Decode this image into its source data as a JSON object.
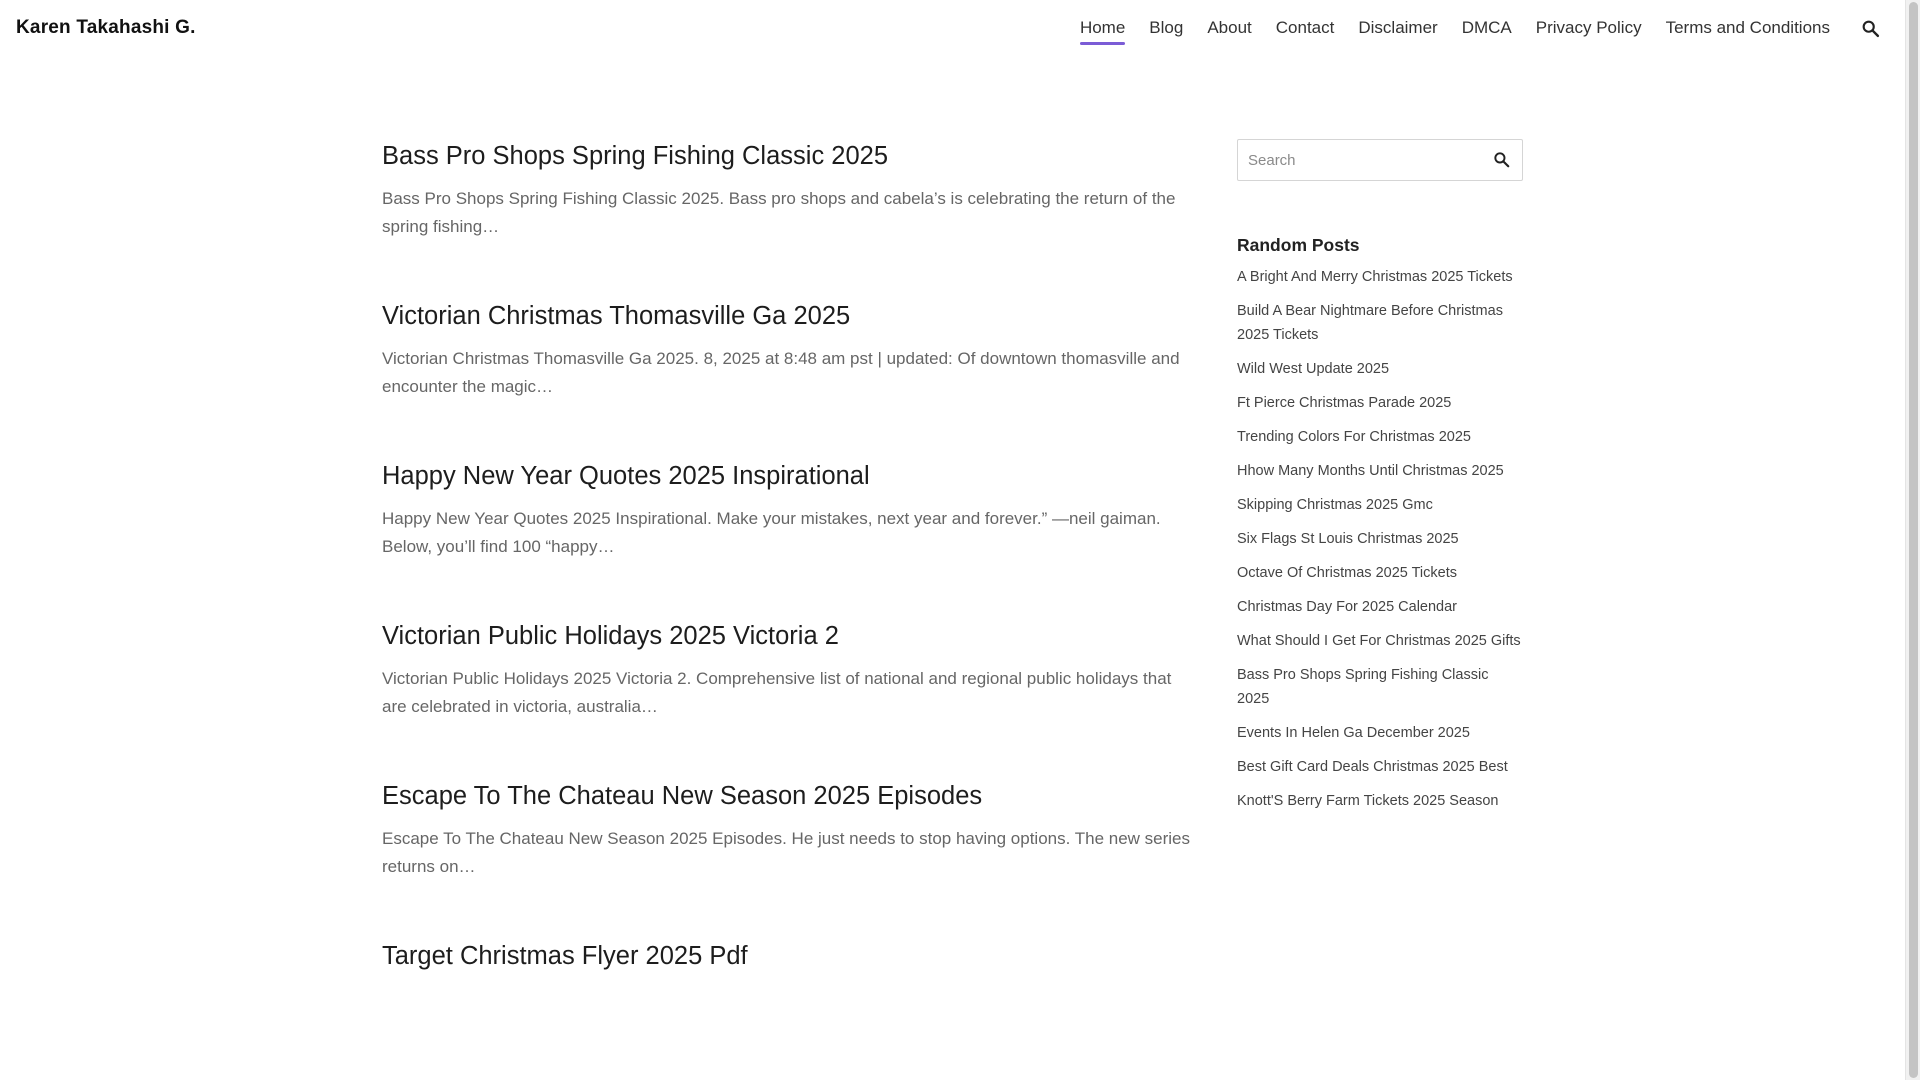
{
  "site": {
    "title": "Karen Takahashi G."
  },
  "nav": {
    "items": [
      {
        "label": "Home"
      },
      {
        "label": "Blog"
      },
      {
        "label": "About"
      },
      {
        "label": "Contact"
      },
      {
        "label": "Disclaimer"
      },
      {
        "label": "DMCA"
      },
      {
        "label": "Privacy Policy"
      },
      {
        "label": "Terms and Conditions"
      }
    ],
    "active": "Home",
    "search_icon": "search-icon"
  },
  "posts": [
    {
      "title": "Bass Pro Shops Spring Fishing Classic 2025",
      "excerpt": "Bass Pro Shops Spring Fishing Classic 2025. Bass pro shops and cabela’s is celebrating the return of the spring fishing…"
    },
    {
      "title": "Victorian Christmas Thomasville Ga 2025",
      "excerpt": "Victorian Christmas Thomasville Ga 2025. 8, 2025 at 8:48 am pst | updated: Of downtown thomasville and encounter the magic…"
    },
    {
      "title": "Happy New Year Quotes 2025 Inspirational",
      "excerpt": "Happy New Year Quotes 2025 Inspirational. Make your mistakes, next year and forever.” —neil gaiman. Below, you’ll find 100 “happy…"
    },
    {
      "title": "Victorian Public Holidays 2025 Victoria 2",
      "excerpt": "Victorian Public Holidays 2025 Victoria 2. Comprehensive list of national and regional public holidays that are celebrated in victoria, australia…"
    },
    {
      "title": "Escape To The Chateau New Season 2025 Episodes",
      "excerpt": "Escape To The Chateau New Season 2025 Episodes. He just needs to stop having options. The new series returns on…"
    },
    {
      "title": "Target Christmas Flyer 2025 Pdf",
      "excerpt": ""
    }
  ],
  "sidebar": {
    "search": {
      "placeholder": "Search",
      "value": ""
    },
    "random_title": "Random Posts",
    "random_posts": [
      "A Bright And Merry Christmas 2025 Tickets",
      "Build A Bear Nightmare Before Christmas 2025 Tickets",
      "Wild West Update 2025",
      "Ft Pierce Christmas Parade 2025",
      "Trending Colors For Christmas 2025",
      "Hhow Many Months Until Christmas 2025",
      "Skipping Christmas 2025 Gmc",
      "Six Flags St Louis Christmas 2025",
      "Octave Of Christmas 2025 Tickets",
      "Christmas Day For 2025 Calendar",
      "What Should I Get For Christmas 2025 Gifts",
      "Bass Pro Shops Spring Fishing Classic 2025",
      "Events In Helen Ga December 2025",
      "Best Gift Card Deals Christmas 2025 Best",
      "Knott'S Berry Farm Tickets 2025 Season"
    ]
  },
  "colors": {
    "accent": "#7b5cd6",
    "text": "#222222",
    "muted": "#666666"
  }
}
